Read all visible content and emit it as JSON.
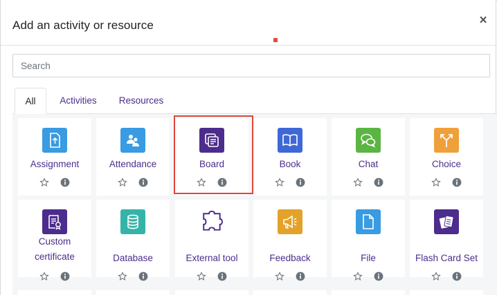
{
  "modal": {
    "title": "Add an activity or resource",
    "close_symbol": "×"
  },
  "search": {
    "placeholder": "Search",
    "value": ""
  },
  "tabs": [
    {
      "label": "All",
      "active": true
    },
    {
      "label": "Activities",
      "active": false
    },
    {
      "label": "Resources",
      "active": false
    }
  ],
  "items": [
    {
      "label": "Assignment",
      "icon": "assignment-icon",
      "color": "#399be2"
    },
    {
      "label": "Attendance",
      "icon": "attendance-icon",
      "color": "#399be2"
    },
    {
      "label": "Board",
      "icon": "board-icon",
      "color": "#4c2c8c",
      "highlighted": true
    },
    {
      "label": "Book",
      "icon": "book-icon",
      "color": "#3f67d6"
    },
    {
      "label": "Chat",
      "icon": "chat-icon",
      "color": "#5bb542"
    },
    {
      "label": "Choice",
      "icon": "choice-icon",
      "color": "#f0a03a"
    },
    {
      "label": "Custom certificate",
      "label_lines": [
        "Custom",
        "certificate"
      ],
      "icon": "certificate-icon",
      "color": "#4c2c8c"
    },
    {
      "label": "Database",
      "icon": "database-icon",
      "color": "#36b3a8"
    },
    {
      "label": "External tool",
      "icon": "puzzle-icon",
      "color": "#4c2c8c"
    },
    {
      "label": "Feedback",
      "icon": "megaphone-icon",
      "color": "#e3a22a"
    },
    {
      "label": "File",
      "icon": "file-icon",
      "color": "#399be2"
    },
    {
      "label": "Flash Card Set",
      "icon": "flashcard-icon",
      "color": "#4c2c8c"
    }
  ],
  "colors": {
    "link": "#4c2c8c",
    "highlight_border": "#e0453b",
    "grid_background": "#f5f6f7"
  }
}
